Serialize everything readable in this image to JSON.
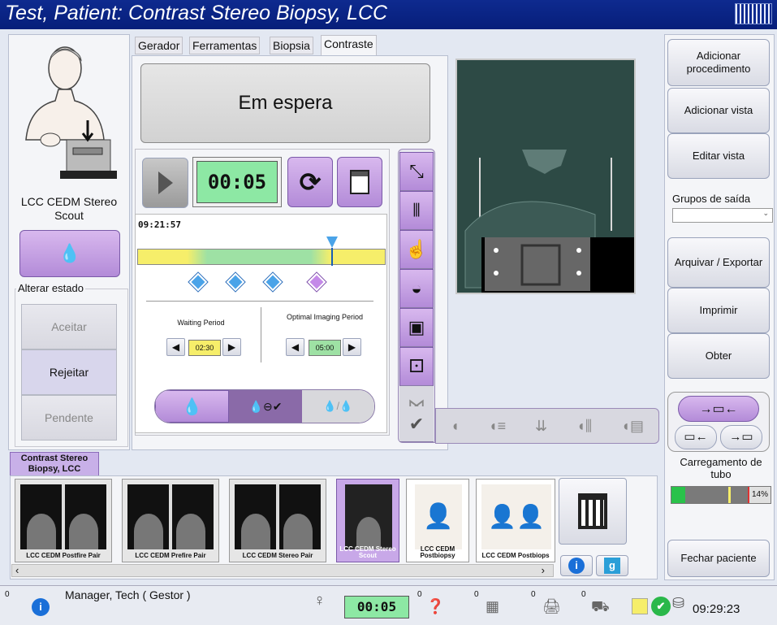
{
  "title": "Test, Patient: Contrast Stereo Biopsy, LCC",
  "tabs": [
    "Gerador",
    "Ferramentas",
    "Biopsia",
    "Contraste"
  ],
  "status_banner": "Em espera",
  "timer": "00:05",
  "clock_time": "09:21:57",
  "waiting_period": {
    "label": "Waiting Period",
    "value": "02:30"
  },
  "optimal_period": {
    "label": "Optimal Imaging Period",
    "value": "05:00"
  },
  "view_name": "LCC CEDM Stereo Scout",
  "alter_state_label": "Alterar estado",
  "state_buttons": [
    "Aceitar",
    "Rejeitar",
    "Pendente"
  ],
  "right_buttons": [
    "Adicionar procedimento",
    "Adicionar vista",
    "Editar vista",
    "Arquivar / Exportar",
    "Imprimir",
    "Obter",
    "Fechar paciente"
  ],
  "output_groups_label": "Grupos de saída",
  "tube_label": "Carregamento de tubo",
  "tube_load": {
    "percent_text": "14%",
    "fraction": 0.14
  },
  "procedure_tab": "Contrast Stereo Biopsy, LCC",
  "thumbnails": [
    "LCC CEDM Postfire Pair",
    "LCC CEDM Prefire Pair",
    "LCC CEDM Stereo Pair",
    "LCC CEDM Stereo Scout",
    "LCC CEDM Postbiopsy",
    "LCC CEDM Postbiops"
  ],
  "status_bar": {
    "zero": "0",
    "user": "Manager, Tech ( Gestor )",
    "timer": "00:05",
    "time": "09:29:23"
  }
}
